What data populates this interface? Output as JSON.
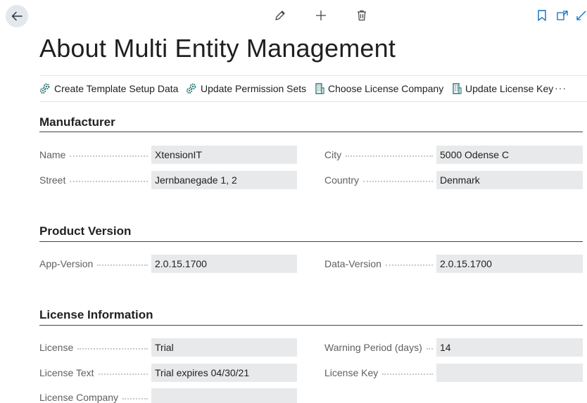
{
  "page": {
    "title": "About Multi Entity Management"
  },
  "actions": [
    {
      "label": "Create Template Setup Data",
      "icon": "gears-icon"
    },
    {
      "label": "Update Permission Sets",
      "icon": "gears-icon"
    },
    {
      "label": "Choose License Company",
      "icon": "building-icon"
    },
    {
      "label": "Update License Key",
      "icon": "building-icon"
    }
  ],
  "more_label": "···",
  "sections": {
    "manufacturer": {
      "title": "Manufacturer",
      "name": {
        "label": "Name",
        "value": "XtensionIT"
      },
      "street": {
        "label": "Street",
        "value": "Jernbanegade 1, 2"
      },
      "city": {
        "label": "City",
        "value": "5000 Odense C"
      },
      "country": {
        "label": "Country",
        "value": "Denmark"
      }
    },
    "product_version": {
      "title": "Product Version",
      "app_version": {
        "label": "App-Version",
        "value": "2.0.15.1700"
      },
      "data_version": {
        "label": "Data-Version",
        "value": "2.0.15.1700"
      }
    },
    "license_information": {
      "title": "License Information",
      "license": {
        "label": "License",
        "value": "Trial"
      },
      "license_text": {
        "label": "License Text",
        "value": "Trial expires 04/30/21"
      },
      "license_company": {
        "label": "License Company",
        "value": ""
      },
      "warning_period": {
        "label": "Warning Period (days)",
        "value": "14"
      },
      "license_key": {
        "label": "License Key",
        "value": ""
      }
    }
  },
  "colors": {
    "accent": "#0f6cbd",
    "action_icon": "#2b7a78",
    "field_bg": "#e8e9ea"
  }
}
